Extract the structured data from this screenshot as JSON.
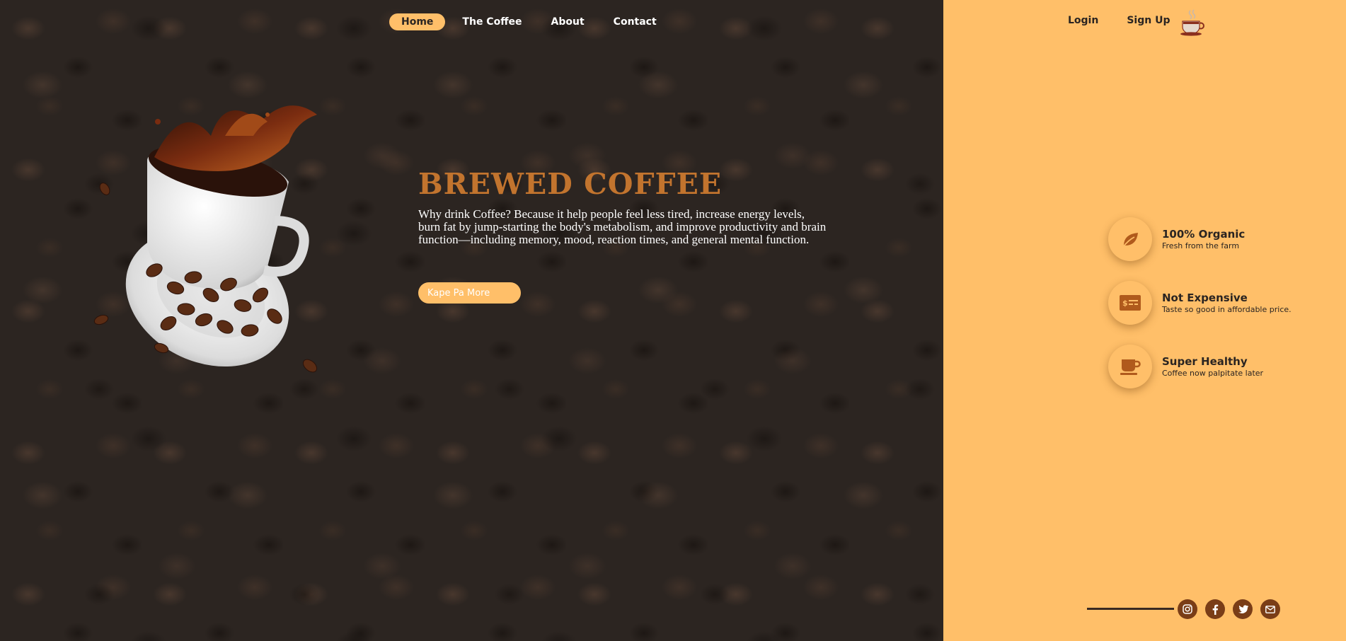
{
  "nav": {
    "items": [
      {
        "label": "Home",
        "active": true
      },
      {
        "label": "The Coffee",
        "active": false
      },
      {
        "label": "About",
        "active": false
      },
      {
        "label": "Contact",
        "active": false
      }
    ]
  },
  "auth": {
    "login_label": "Login",
    "signup_label": "Sign Up",
    "logo_icon": "coffee-cup-logo-icon"
  },
  "hero": {
    "title": "BREWED COFFEE",
    "description": "Why drink Coffee? Because it help people feel less tired, increase energy levels, burn fat by jump-starting the body's metabolism, and improve productivity and brain function—including memory, mood, reaction times, and general mental function.",
    "cta_label": "Kape Pa More"
  },
  "features": [
    {
      "icon": "leaf-icon",
      "title": "100% Organic",
      "subtitle": "Fresh from the farm"
    },
    {
      "icon": "money-card-icon",
      "title": "Not Expensive",
      "subtitle": "Taste so good in affordable price."
    },
    {
      "icon": "mug-icon",
      "title": "Super Healthy",
      "subtitle": "Coffee now palpitate later"
    }
  ],
  "social": [
    {
      "icon": "instagram-icon",
      "glyph": "◎"
    },
    {
      "icon": "facebook-icon",
      "glyph": "f"
    },
    {
      "icon": "twitter-icon",
      "glyph": "t"
    },
    {
      "icon": "mail-icon",
      "glyph": "✉"
    }
  ],
  "colors": {
    "accent": "#ffbf69",
    "title_brown": "#c2742e",
    "dark_bg": "#2c2521",
    "icon_brown": "#7a3d17"
  }
}
